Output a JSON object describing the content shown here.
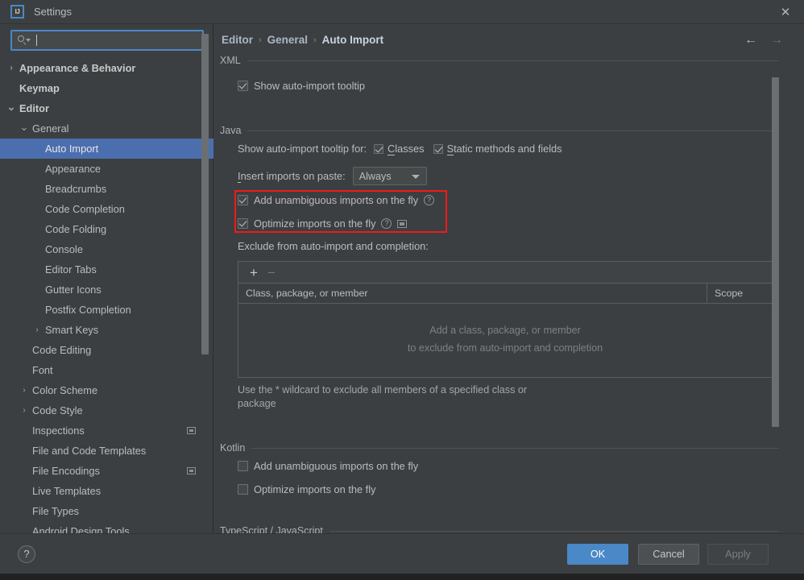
{
  "window": {
    "title": "Settings",
    "logo_text": "IJ",
    "close_icon": "✕"
  },
  "sidebar": {
    "search": {
      "value": "",
      "placeholder": ""
    },
    "items": [
      {
        "label": "Appearance & Behavior",
        "indent": 0,
        "chevron": "›",
        "bold": true,
        "selected": false,
        "badge": false
      },
      {
        "label": "Keymap",
        "indent": 0,
        "chevron": "",
        "bold": true,
        "selected": false,
        "badge": false
      },
      {
        "label": "Editor",
        "indent": 0,
        "chevron": "⌄",
        "bold": true,
        "selected": false,
        "badge": false
      },
      {
        "label": "General",
        "indent": 1,
        "chevron": "⌄",
        "bold": false,
        "selected": false,
        "badge": false
      },
      {
        "label": "Auto Import",
        "indent": 2,
        "chevron": "",
        "bold": false,
        "selected": true,
        "badge": false
      },
      {
        "label": "Appearance",
        "indent": 2,
        "chevron": "",
        "bold": false,
        "selected": false,
        "badge": false
      },
      {
        "label": "Breadcrumbs",
        "indent": 2,
        "chevron": "",
        "bold": false,
        "selected": false,
        "badge": false
      },
      {
        "label": "Code Completion",
        "indent": 2,
        "chevron": "",
        "bold": false,
        "selected": false,
        "badge": false
      },
      {
        "label": "Code Folding",
        "indent": 2,
        "chevron": "",
        "bold": false,
        "selected": false,
        "badge": false
      },
      {
        "label": "Console",
        "indent": 2,
        "chevron": "",
        "bold": false,
        "selected": false,
        "badge": false
      },
      {
        "label": "Editor Tabs",
        "indent": 2,
        "chevron": "",
        "bold": false,
        "selected": false,
        "badge": false
      },
      {
        "label": "Gutter Icons",
        "indent": 2,
        "chevron": "",
        "bold": false,
        "selected": false,
        "badge": false
      },
      {
        "label": "Postfix Completion",
        "indent": 2,
        "chevron": "",
        "bold": false,
        "selected": false,
        "badge": false
      },
      {
        "label": "Smart Keys",
        "indent": 2,
        "chevron": "›",
        "bold": false,
        "selected": false,
        "badge": false
      },
      {
        "label": "Code Editing",
        "indent": 1,
        "chevron": "",
        "bold": false,
        "selected": false,
        "badge": false
      },
      {
        "label": "Font",
        "indent": 1,
        "chevron": "",
        "bold": false,
        "selected": false,
        "badge": false
      },
      {
        "label": "Color Scheme",
        "indent": 1,
        "chevron": "›",
        "bold": false,
        "selected": false,
        "badge": false
      },
      {
        "label": "Code Style",
        "indent": 1,
        "chevron": "›",
        "bold": false,
        "selected": false,
        "badge": false
      },
      {
        "label": "Inspections",
        "indent": 1,
        "chevron": "",
        "bold": false,
        "selected": false,
        "badge": true
      },
      {
        "label": "File and Code Templates",
        "indent": 1,
        "chevron": "",
        "bold": false,
        "selected": false,
        "badge": false
      },
      {
        "label": "File Encodings",
        "indent": 1,
        "chevron": "",
        "bold": false,
        "selected": false,
        "badge": true
      },
      {
        "label": "Live Templates",
        "indent": 1,
        "chevron": "",
        "bold": false,
        "selected": false,
        "badge": false
      },
      {
        "label": "File Types",
        "indent": 1,
        "chevron": "",
        "bold": false,
        "selected": false,
        "badge": false
      },
      {
        "label": "Android Design Tools",
        "indent": 1,
        "chevron": "",
        "bold": false,
        "selected": false,
        "badge": false
      }
    ]
  },
  "breadcrumb": {
    "items": [
      "Editor",
      "General",
      "Auto Import"
    ],
    "separator": "›"
  },
  "nav": {
    "back_icon": "←",
    "forward_icon": "→"
  },
  "main": {
    "xml": {
      "title": "XML",
      "show_tooltip": {
        "label": "Show auto-import tooltip",
        "checked": true
      }
    },
    "java": {
      "title": "Java",
      "tooltip_for_label": "Show auto-import tooltip for:",
      "classes": {
        "label": "Classes",
        "mnemonic": "C",
        "rest": "lasses",
        "checked": true
      },
      "static_members": {
        "label": "Static methods and fields",
        "mnemonic": "S",
        "rest": "tatic methods and fields",
        "checked": true
      },
      "insert_imports": {
        "label_mnemonic": "I",
        "label_rest": "nsert imports on paste:",
        "value": "Always"
      },
      "add_unambiguous": {
        "label": "Add unambiguous imports on the fly",
        "checked": true,
        "help": "?"
      },
      "optimize_imports": {
        "label": "Optimize imports on the fly",
        "checked": true,
        "help": "?"
      },
      "exclude_label": "Exclude from auto-import and completion:",
      "toolbar": {
        "add": "+",
        "remove": "−"
      },
      "table": {
        "columns": [
          "Class, package, or member",
          "Scope"
        ],
        "rows": [],
        "empty_line1": "Add a class, package, or member",
        "empty_line2": "to exclude from auto-import and completion"
      },
      "hint_line1": "Use the * wildcard to exclude all members of a specified class or",
      "hint_line2": "package"
    },
    "kotlin": {
      "title": "Kotlin",
      "add_unambiguous": {
        "label": "Add unambiguous imports on the fly",
        "checked": false
      },
      "optimize_imports": {
        "label": "Optimize imports on the fly",
        "checked": false
      }
    },
    "typescript": {
      "title": "TypeScript / JavaScript"
    }
  },
  "footer": {
    "help": "?",
    "ok": "OK",
    "cancel": "Cancel",
    "apply": "Apply"
  },
  "colors": {
    "accent": "#4a88c7",
    "selection": "#4b6eaf",
    "highlight_box": "#ef1b1b",
    "background": "#3c3f41"
  }
}
